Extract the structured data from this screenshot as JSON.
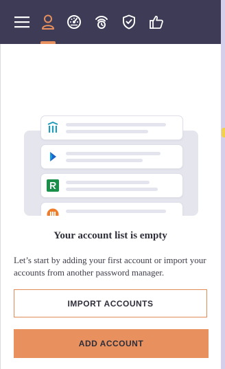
{
  "toolbar": {
    "items": [
      {
        "icon": "menu-icon",
        "active": false
      },
      {
        "icon": "user-icon",
        "active": true
      },
      {
        "icon": "dashboard-gauge-icon",
        "active": false
      },
      {
        "icon": "alarm-radar-icon",
        "active": false
      },
      {
        "icon": "shield-check-icon",
        "active": false
      },
      {
        "icon": "thumbs-up-icon",
        "active": false
      }
    ],
    "active_color": "#e8915f",
    "icon_color": "#ffffff",
    "background": "#3d3b55"
  },
  "empty_state": {
    "title": "Your account list is empty",
    "description": "Let’s start by adding your first account or import your accounts from another password manager.",
    "illustration_cards": [
      {
        "icon": "teal-brand-icon"
      },
      {
        "icon": "blue-arrow-brand-icon"
      },
      {
        "icon": "green-r-brand-icon",
        "letter": "R"
      },
      {
        "icon": "orange-brand-icon"
      }
    ]
  },
  "actions": {
    "import_label": "IMPORT ACCOUNTS",
    "add_label": "ADD ACCOUNT",
    "accent_color": "#e8915f"
  }
}
